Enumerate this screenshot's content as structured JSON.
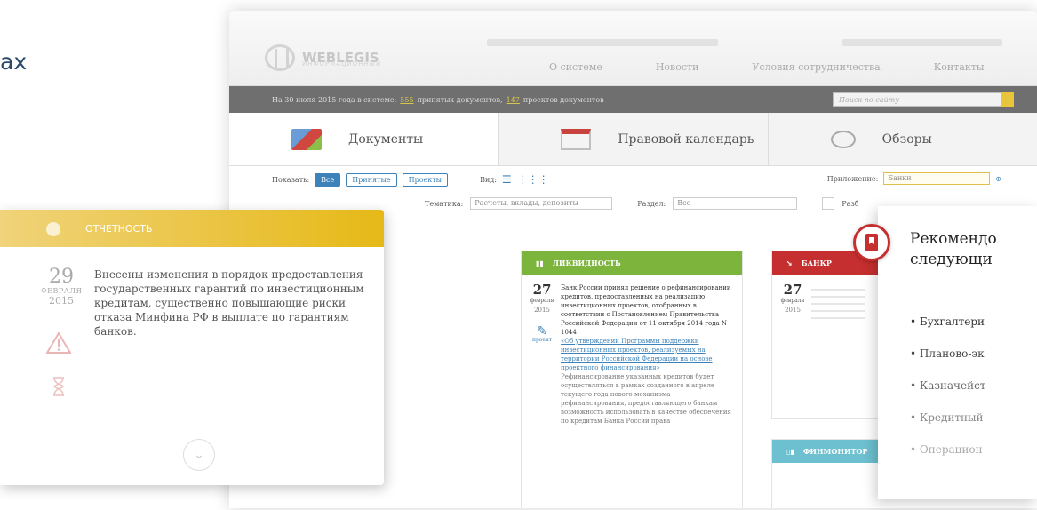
{
  "edge_text": "ах",
  "site": {
    "logo": "WEBLEGIS",
    "logo_sub": "ИНФОРМАЦИОННЫЙ",
    "nav": [
      "О системе",
      "Новости",
      "Условия сотрудничества",
      "Контакты"
    ]
  },
  "status_bar": {
    "prefix": "На 30 июля 2015 года в системе:",
    "docs_count": "555",
    "docs_label": "принятых документов,",
    "projects_count": "147",
    "projects_label": "проектов документов",
    "search_placeholder": "Поиск по сайту"
  },
  "tabs": [
    "Документы",
    "Правовой календарь",
    "Обзоры"
  ],
  "filters": {
    "show_label": "Показать:",
    "show_options": [
      "Все",
      "Принятые",
      "Проекты"
    ],
    "view_label": "Вид:",
    "app_label": "Приложение:",
    "app_value": "Банки",
    "topics_label": "Тематика:",
    "topics_value": "Расчеты, вклады, депозиты",
    "section_label": "Раздел:",
    "section_value": "Все",
    "extra_label": "Разб"
  },
  "cards": [
    {
      "title": "ЛИКВИДНОСТЬ",
      "color": "#7db53c",
      "day": "27",
      "month": "февраля",
      "year": "2015",
      "tag": "проект",
      "text1": "Банк России принял решение о рефинансировании кредитов, предоставленных на реализацию инвестиционных проектов, отобранных в соответствии с Постановлением Правительства Российской Федерации от 11 октября 2014 года N 1044",
      "link": "«Об утверждении Программы поддержки инвестиционных проектов, реализуемых на территории Российской Федерации на основе проектного финансирования»",
      "text2": "Рефинансирование указанных кредитов будет осуществляться в рамках созданного в апреле текущего года нового механизма рефинансирования, предоставляющего банкам возможность использовать в качестве обеспечения по кредитам Банка России права"
    },
    {
      "title": "БАНКР",
      "color": "#c62f2f",
      "day": "27",
      "month": "февраля",
      "year": "2015"
    },
    {
      "title": "ФИНМОНИТОР",
      "color": "#6cc0d0"
    }
  ],
  "left_panel": {
    "title": "ОТЧЕТНОСТЬ",
    "day": "29",
    "month": "ФЕВРАЛЯ",
    "year": "2015",
    "text": "Внесены изменения в порядок предоставления государственных гарантий по инвестиционным кредитам, существенно повышающие риски отказа Минфина РФ в выплате по гарантиям банков."
  },
  "right_panel": {
    "title_line1": "Рекомендо",
    "title_line2": "следующи",
    "items": [
      "Бухгалтери",
      "Планово-эк",
      "Казначейст",
      "Кредитный",
      "Операцион"
    ]
  },
  "colors": {
    "accent_blue": "#3d82b8",
    "yellow": "#e6b917",
    "green": "#7db53c",
    "red": "#c62f2f"
  }
}
